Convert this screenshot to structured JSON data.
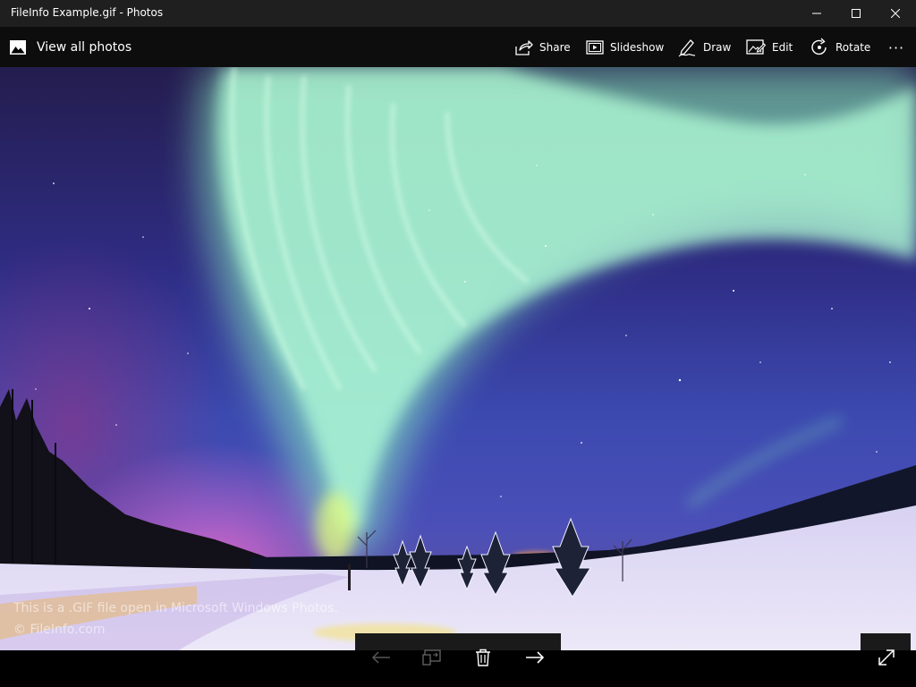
{
  "window": {
    "title": "FileInfo Example.gif - Photos"
  },
  "toolbar": {
    "view_all_label": "View all photos",
    "share_label": "Share",
    "slideshow_label": "Slideshow",
    "draw_label": "Draw",
    "edit_label": "Edit",
    "rotate_label": "Rotate",
    "more_label": "···"
  },
  "overlay": {
    "line1": "This is a .GIF file open in Microsoft Windows Photos.",
    "line2": "© FileInfo.com"
  },
  "icons": {
    "view_all": "photo-icon",
    "share": "share-icon",
    "slideshow": "slideshow-icon",
    "draw": "draw-icon",
    "edit": "edit-icon",
    "rotate": "rotate-icon",
    "previous": "arrow-left-icon",
    "cast": "cast-icon",
    "delete": "trash-icon",
    "next": "arrow-right-icon",
    "fullscreen": "fullscreen-icon"
  },
  "colors": {
    "titlebar": "#1f1f1f",
    "commandbar": "#0d0d0d",
    "aurora": "#8fffc8",
    "sky": "#3c4ab0",
    "snow": "#e6e3f5"
  }
}
